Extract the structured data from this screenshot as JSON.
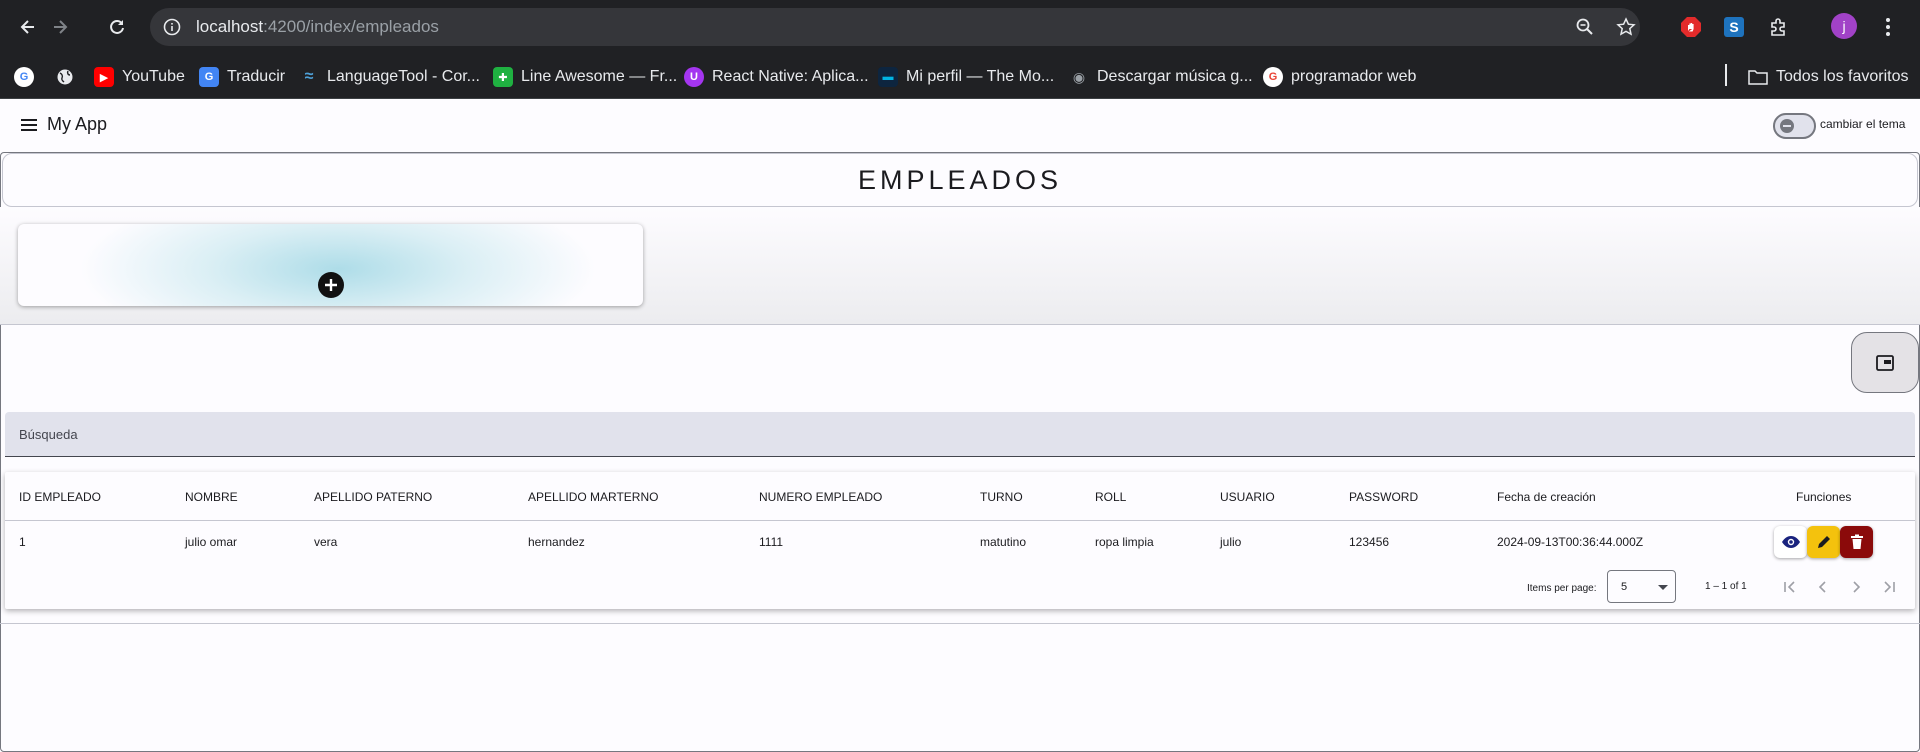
{
  "browser": {
    "url_host": "localhost",
    "url_rest": ":4200/index/empleados",
    "profile_initial": "j",
    "bookmarks": [
      {
        "label": "YouTube",
        "icon": "youtube-icon",
        "color": "#ff0000"
      },
      {
        "label": "Traducir",
        "icon": "google-translate-icon",
        "color": "#4285f4"
      },
      {
        "label": "LanguageTool - Cor...",
        "icon": "languagetool-icon",
        "color": "#2b80b9"
      },
      {
        "label": "Line Awesome — Fr...",
        "icon": "line-awesome-icon",
        "color": "#1fb141"
      },
      {
        "label": "React Native: Aplica...",
        "icon": "udemy-icon",
        "color": "#a435f0"
      },
      {
        "label": "Mi perfil — The Mo...",
        "icon": "movie-db-icon",
        "color": "#0d253f"
      },
      {
        "label": "Descargar música g...",
        "icon": "music-icon",
        "color": "#5f6368"
      },
      {
        "label": "programador web",
        "icon": "google-icon",
        "color": "#ffffff"
      }
    ],
    "all_bookmarks_label": "Todos los favoritos"
  },
  "toolbar": {
    "title": "My App",
    "theme_toggle_label": "cambiar el tema"
  },
  "page": {
    "title": "EMPLEADOS",
    "search_placeholder": "Búsqueda"
  },
  "table": {
    "headers": [
      "ID EMPLEADO",
      "NOMBRE",
      "APELLIDO PATERNO",
      "APELLIDO MARTERNO",
      "NUMERO EMPLEADO",
      "TURNO",
      "ROLL",
      "USUARIO",
      "PASSWORD",
      "Fecha de creación",
      "Funciones"
    ],
    "rows": [
      [
        "1",
        "julio omar",
        "vera",
        "hernandez",
        "1111",
        "matutino",
        "ropa limpia",
        "julio",
        "123456",
        "2024-09-13T00:36:44.000Z"
      ]
    ]
  },
  "paginator": {
    "items_per_page_label": "Items per page:",
    "page_size": "5",
    "range_label": "1 – 1 of 1"
  },
  "colors": {
    "view_button": "#ffffff",
    "edit_button": "#f4c20d",
    "delete_button": "#8b0a0a"
  }
}
